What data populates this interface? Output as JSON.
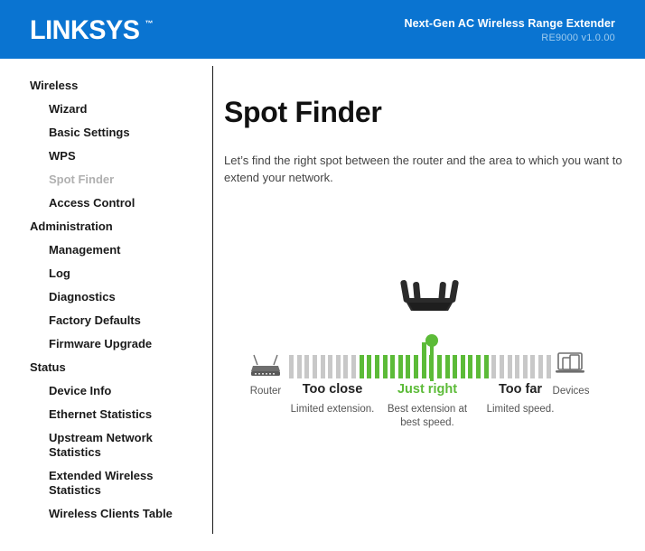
{
  "header": {
    "logo_text": "LINKSYS",
    "logo_tm": "™",
    "product_name": "Next-Gen AC Wireless Range Extender",
    "model_version": "RE9000 v1.0.00",
    "brand_color": "#0a74d1"
  },
  "sidebar": {
    "groups": [
      {
        "title": "Wireless",
        "items": [
          {
            "label": "Wizard",
            "active": false
          },
          {
            "label": "Basic Settings",
            "active": false
          },
          {
            "label": "WPS",
            "active": false
          },
          {
            "label": "Spot Finder",
            "active": true
          },
          {
            "label": "Access Control",
            "active": false
          }
        ]
      },
      {
        "title": "Administration",
        "items": [
          {
            "label": "Management",
            "active": false
          },
          {
            "label": "Log",
            "active": false
          },
          {
            "label": "Diagnostics",
            "active": false
          },
          {
            "label": "Factory Defaults",
            "active": false
          },
          {
            "label": "Firmware Upgrade",
            "active": false
          }
        ]
      },
      {
        "title": "Status",
        "items": [
          {
            "label": "Device Info",
            "active": false
          },
          {
            "label": "Ethernet Statistics",
            "active": false
          },
          {
            "label": "Upstream Network Statistics",
            "active": false
          },
          {
            "label": "Extended Wireless Statistics",
            "active": false
          },
          {
            "label": "Wireless Clients Table",
            "active": false
          }
        ]
      }
    ]
  },
  "main": {
    "title": "Spot Finder",
    "description": "Let’s find the right spot between the router and the area to which you want to extend your network.",
    "spot_finder": {
      "endpoints": {
        "left_label": "Router",
        "left_icon": "router-icon",
        "right_label": "Devices",
        "right_icon": "devices-icon"
      },
      "extender_icon": "range-extender-icon",
      "marker_icon": "location-marker-icon",
      "zones": [
        {
          "title": "Too close",
          "subtitle": "Limited extension.",
          "state": "bad",
          "color": "#222222"
        },
        {
          "title": "Just right",
          "subtitle": "Best extension at best speed.",
          "state": "good",
          "color": "#5cbb38"
        },
        {
          "title": "Too far",
          "subtitle": "Limited speed.",
          "state": "bad",
          "color": "#222222"
        }
      ],
      "signal_bars": {
        "total": 34,
        "green_start_index": 9,
        "green_end_index": 25,
        "marker_bar_index": 17,
        "gray_color": "#c8c8c8",
        "green_color": "#5cbb38"
      }
    }
  }
}
